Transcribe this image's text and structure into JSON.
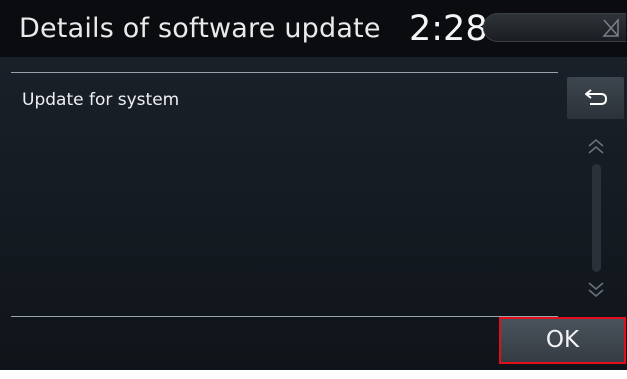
{
  "header": {
    "title": "Details of software update",
    "clock": "2:28",
    "signal_icon": "no-signal-icon"
  },
  "content": {
    "item_label": "Update for system"
  },
  "controls": {
    "back_icon": "back-arrow-icon",
    "scroll_up_icon": "chevron-up-icon",
    "scroll_down_icon": "chevron-down-icon",
    "ok_label": "OK"
  },
  "colors": {
    "header_bg": "#0a0c0f",
    "screen_bg": "#161c23",
    "highlight": "#e0101a",
    "text": "#eef0f2"
  }
}
